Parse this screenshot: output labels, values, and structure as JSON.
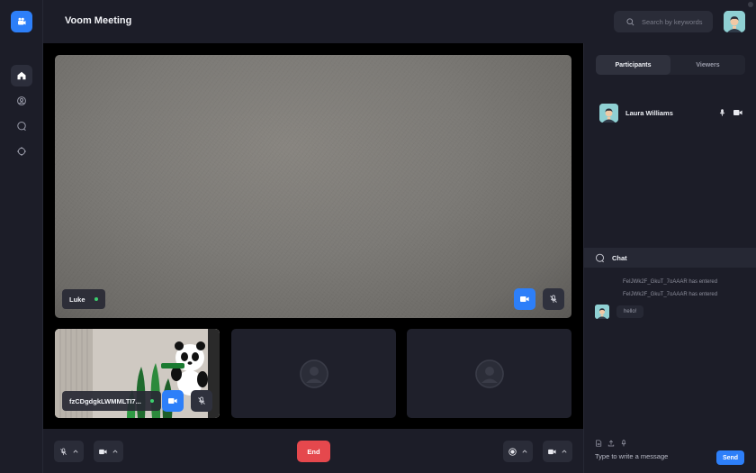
{
  "app": {
    "title": "Voom Meeting"
  },
  "header": {
    "search_placeholder": "Search by keywords"
  },
  "rail": {
    "items": [
      "home-icon",
      "profile-icon",
      "chat-icon",
      "settings-icon"
    ]
  },
  "stage": {
    "main": {
      "name": "Luke"
    },
    "tiles": [
      {
        "name": "fzCDgdgkLWMMLTI7..."
      },
      {
        "name": ""
      },
      {
        "name": ""
      }
    ]
  },
  "bottombar": {
    "end_label": "End"
  },
  "panel": {
    "tabs": [
      "Participants",
      "Viewers"
    ],
    "participants": [
      {
        "name": "Laura Williams"
      }
    ],
    "chat": {
      "title": "Chat",
      "system_messages": [
        "FeIJWk2F_GkuT_7oAAAR has entered",
        "FeIJWk2F_GkuT_7oAAAR has entered"
      ],
      "messages": [
        {
          "text": "hello!"
        }
      ],
      "input_placeholder": "Type to write a message",
      "send_label": "Send"
    }
  },
  "colors": {
    "accent": "#2d7ff9",
    "danger": "#e5484d",
    "online": "#3ccf6e",
    "background": "#1a1b25"
  }
}
